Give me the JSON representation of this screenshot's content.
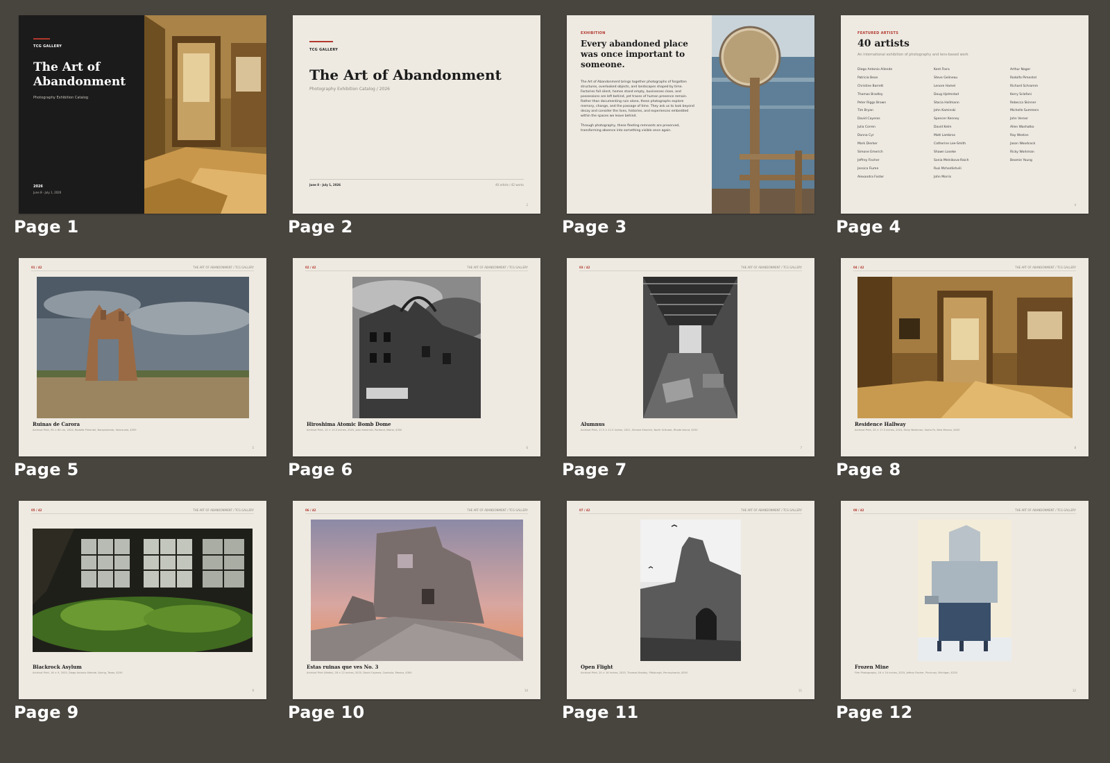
{
  "catalog": {
    "gallery": "TCG GALLERY",
    "title": "The Art of Abandonment",
    "title_line1": "The Art of",
    "title_line2": "Abandonment",
    "subtitle": "Photography Exhibition Catalog",
    "subtitle_with_year": "Photography Exhibition Catalog  /  2026",
    "year": "2026",
    "dates": "June 8 - July 1, 2026",
    "counts": "40 artists  /  42 works",
    "running_head": "THE ART OF ABANDONMENT  /  TCG GALLERY"
  },
  "pages": [
    {
      "label": "Page 1"
    },
    {
      "label": "Page 2",
      "number": "2"
    },
    {
      "label": "Page 3"
    },
    {
      "label": "Page 4",
      "number": "4"
    },
    {
      "label": "Page 5",
      "number": "5"
    },
    {
      "label": "Page 6",
      "number": "6"
    },
    {
      "label": "Page 7",
      "number": "7"
    },
    {
      "label": "Page 8",
      "number": "8"
    },
    {
      "label": "Page 9",
      "number": "9"
    },
    {
      "label": "Page 10",
      "number": "10"
    },
    {
      "label": "Page 11",
      "number": "11"
    },
    {
      "label": "Page 12",
      "number": "12"
    }
  ],
  "exhibition": {
    "label": "EXHIBITION",
    "heading": "Every abandoned place was once important to someone.",
    "paragraph1": "The Art of Abandonment brings together photographs of forgotten structures, overlooked objects, and landscapes shaped by time. Factories fall silent, homes stand empty, businesses close, and possessions are left behind, yet traces of human presence remain. Rather than documenting ruin alone, these photographs explore memory, change, and the passage of time. They ask us to look beyond decay and consider the lives, histories, and experiences embedded within the spaces we leave behind.",
    "paragraph2": "Through photography, these fleeting remnants are preserved, transforming absence into something visible once again."
  },
  "artists": {
    "label": "FEATURED ARTISTS",
    "count": "40 artists",
    "subtitle": "An international exhibition of photography and lens-based work",
    "col1": [
      "Diego Antonio Allende",
      "Patricia Bean",
      "Christine Barrett",
      "Thomas Bradley",
      "Peter Riggs Brown",
      "Tim Bryan",
      "David Cayeros",
      "Julia Corren",
      "Donna Cyr",
      "Mark Dierker",
      "Simone Emerich",
      "Jeffrey Fischer",
      "Jessica Fiume",
      "Alexandra Foster"
    ],
    "col2": [
      "Kent Flora",
      "Steve Gelineau",
      "Lenore Hamel",
      "Doug Hjelmstad",
      "Stacia Hollmann",
      "John Kaminski",
      "Spencer Kenney",
      "David Kelm",
      "Matt Lambros",
      "Catherine Lee-Smith",
      "Shawn Loseke",
      "Sonia Melnikova-Raich",
      "Rusi Mchedlishvili",
      "John Morris"
    ],
    "col3": [
      "Arthur Nager",
      "Rodolfo Pimentel",
      "Richard Schramm",
      "Kerry Sclafani",
      "Rebecca Skinner",
      "Michelle Summers",
      "John Verner",
      "Allen Washatko",
      "Ray Weston",
      "Jason Woodcock",
      "Ricky Workman",
      "Beamie Young"
    ]
  },
  "artworks": [
    {
      "num": "01 / 42",
      "title": "Ruinas de Carora",
      "caption": "Archival Print, 90 × 60 cm, 2024, Rodolfo Pimentel, Barquisimeto, Venezuela, $359"
    },
    {
      "num": "02 / 42",
      "title": "Hiroshima Atomic Bomb Dome",
      "caption": "Archival Print, 10 × 13.5 inches, 2025, John Kaminski, Portland, Maine, $350"
    },
    {
      "num": "03 / 42",
      "title": "Alumnus",
      "caption": "Archival Print, 17.5 × 11.5 inches, 2021, Simone Emerich, North Scituate, Rhode Island, $250"
    },
    {
      "num": "04 / 42",
      "title": "Residence Hallway",
      "caption": "Archival Print, 20 × 17.5 inches, 2024, Ricky Workman, Santa Fe, New Mexico, $450"
    },
    {
      "num": "05 / 42",
      "title": "Blackrock Asylum",
      "caption": "Archival Print, 16 × 9, 2025, Diego Antonio Allende, Spring, Texas, $250"
    },
    {
      "num": "06 / 42",
      "title": "Estas ruinas que ves No. 3",
      "caption": "Archival Print (Matte), 28 × 22 inches, 2025, David Cayeros, Coahuila, Mexico, $300"
    },
    {
      "num": "07 / 42",
      "title": "Open Flight",
      "caption": "Archival Print, 20 × 16 inches, 2025, Thomas Bradley, Pittsburgh, Pennsylvania, $350"
    },
    {
      "num": "08 / 42",
      "title": "Frozen Mine",
      "caption": "Film Photography, 16 × 24 inches, 2025, Jeffrey Fischer, Pinckney, Michigan, $250"
    }
  ],
  "colors": {
    "board": "#48453f",
    "paper": "#eeeae2",
    "cover_dark": "#1b1b1b",
    "accent": "#b2382d"
  }
}
